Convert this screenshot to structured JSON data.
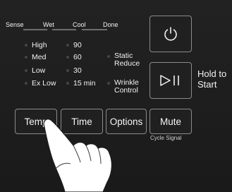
{
  "stages": [
    "Sense",
    "Wet",
    "Cool",
    "Done"
  ],
  "temp_options": [
    "High",
    "Med",
    "Low",
    "Ex Low"
  ],
  "time_options": [
    "90",
    "60",
    "30",
    "15 min"
  ],
  "extra_options": {
    "static_reduce": "Static\nReduce",
    "wrinkle_control": "Wrinkle\nControl"
  },
  "buttons": {
    "temp": "Temp",
    "time": "Time",
    "options": "Options",
    "mute": "Mute"
  },
  "hold_to_start": "Hold to\nStart",
  "cycle_signal": "Cycle Signal",
  "icons": {
    "power": "power-icon",
    "start_pause": "play-pause-icon"
  }
}
